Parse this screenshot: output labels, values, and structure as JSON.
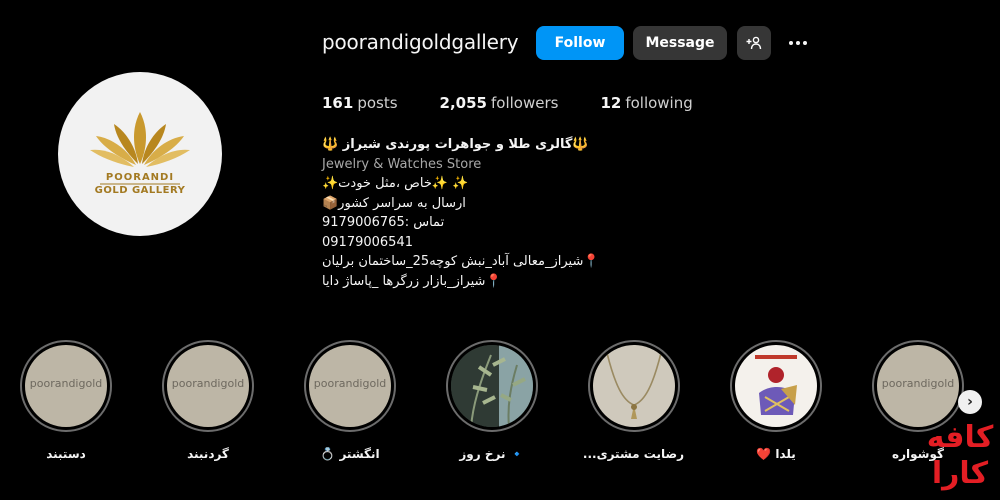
{
  "profile": {
    "username": "poorandigoldgallery",
    "follow_label": "Follow",
    "message_label": "Message",
    "logo_line1": "POORANDI",
    "logo_line2": "GOLD GALLERY"
  },
  "stats": {
    "posts_count": "161",
    "posts_label": "posts",
    "followers_count": "2,055",
    "followers_label": "followers",
    "following_count": "12",
    "following_label": "following"
  },
  "bio": {
    "title": "🔱گالری طلا و جواهرات پورندی شیراز 🔱",
    "category": "Jewelry & Watches Store",
    "line1": "✨ ✨خاص ،مثل خودت✨",
    "line2": "ارسال به سراسر کشور📦",
    "line3": "تماس :9179006765",
    "line4": "09179006541",
    "line5": "📍شیراز_معالی آباد_نبش کوچه25_ساختمان برلیان",
    "line6": "📍شیراز_بازار زرگرها _پاساژ دایا"
  },
  "highlights": [
    {
      "label": "دستبند",
      "watermark": "poorandigold"
    },
    {
      "label": "گردنبند",
      "watermark": "poorandigold"
    },
    {
      "label": "انگشتر 💍",
      "watermark": "poorandigold"
    },
    {
      "label": "🔹 نرخ روز",
      "watermark": ""
    },
    {
      "label": "رضایت مشتری...",
      "watermark": ""
    },
    {
      "label": "یلدا ❤️",
      "watermark": ""
    },
    {
      "label": "گوشواره",
      "watermark": "poorandigold"
    }
  ],
  "watermark_site": "کافه\nکارا",
  "colors": {
    "follow": "#0095f6",
    "secondary_button": "#363636",
    "background": "#000000",
    "logo_gold": "#a37a22"
  }
}
